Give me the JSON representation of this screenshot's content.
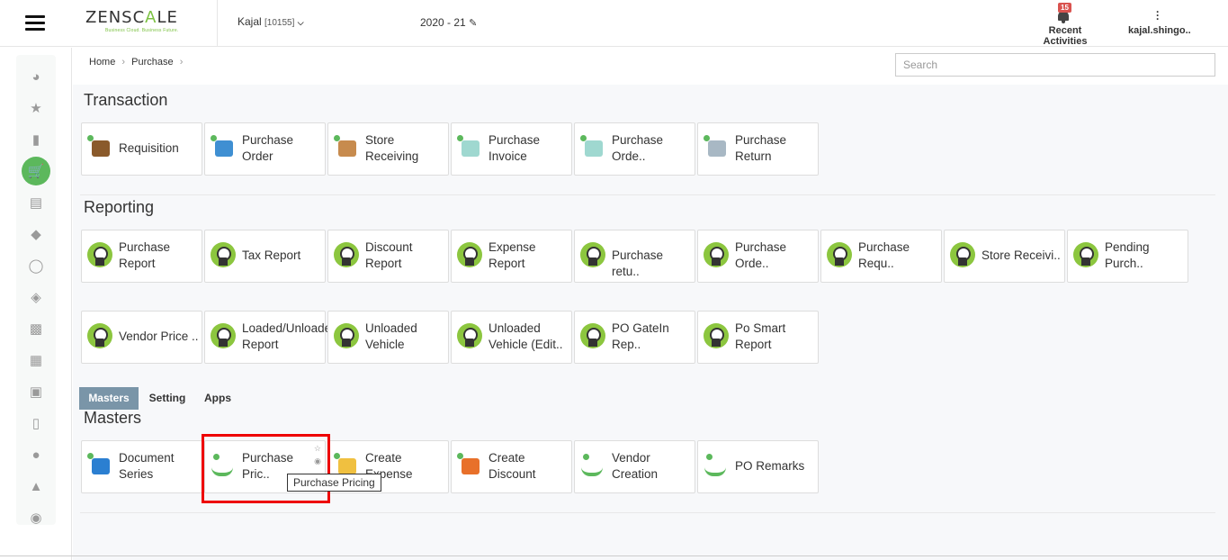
{
  "header": {
    "logo_main": "ZENSCALE",
    "logo_prefix": "ZENSC",
    "logo_accent": "A",
    "logo_suffix": "LE",
    "logo_tagline": "Business Cloud. Business Future.",
    "company": "Kajal",
    "company_code": "[10155]",
    "year": "2020 - 21",
    "notifications_count": "15",
    "recent_label": "Recent Activities",
    "user_label": "kajal.shingo.."
  },
  "breadcrumb": {
    "home": "Home",
    "current": "Purchase",
    "sep": "›"
  },
  "search": {
    "placeholder": "Search"
  },
  "sections": {
    "transaction": "Transaction",
    "reporting": "Reporting",
    "masters": "Masters"
  },
  "transaction_tiles": [
    {
      "label": "Requisition"
    },
    {
      "label": "Purchase Order"
    },
    {
      "label": "Store Receiving"
    },
    {
      "label": "Purchase Invoice"
    },
    {
      "label": "Purchase Orde.."
    },
    {
      "label": "Purchase Return"
    }
  ],
  "reporting_tiles": [
    {
      "label": "Purchase Report"
    },
    {
      "label": "Tax Report"
    },
    {
      "label": "Discount Report"
    },
    {
      "label": "Expense Report"
    },
    {
      "label": "Purchase retu.."
    },
    {
      "label": "Purchase Orde.."
    },
    {
      "label": "Purchase Requ.."
    },
    {
      "label": "Store Receivi.."
    },
    {
      "label": "Pending Purch.."
    },
    {
      "label": "Vendor Price .."
    },
    {
      "label": "Loaded/Unloaded Report"
    },
    {
      "label": "Unloaded Vehicle"
    },
    {
      "label": "Unloaded Vehicle (Edit.."
    },
    {
      "label": "PO GateIn Rep.."
    },
    {
      "label": "Po Smart Report"
    }
  ],
  "tabs": [
    "Masters",
    "Setting",
    "Apps"
  ],
  "masters_tiles": [
    {
      "label": "Document Series"
    },
    {
      "label": "Purchase Pric.."
    },
    {
      "label": "Create Expense"
    },
    {
      "label": "Create Discount"
    },
    {
      "label": "Vendor Creation"
    },
    {
      "label": "PO Remarks"
    }
  ],
  "tooltip": "Purchase Pricing",
  "colors": {
    "accent": "#5cb85c",
    "highlight": "#ee0000",
    "tab_active": "#7a95a8",
    "badge": "#d9534f"
  },
  "sidebar_icons": [
    "dashboard-icon",
    "star-icon",
    "file-icon",
    "cart-icon",
    "book-icon",
    "tag-icon",
    "bulb-icon",
    "ticket-icon",
    "cubes-icon",
    "qrcode-icon",
    "money-icon",
    "document-icon",
    "users-icon",
    "person-icon",
    "chat-icon"
  ]
}
